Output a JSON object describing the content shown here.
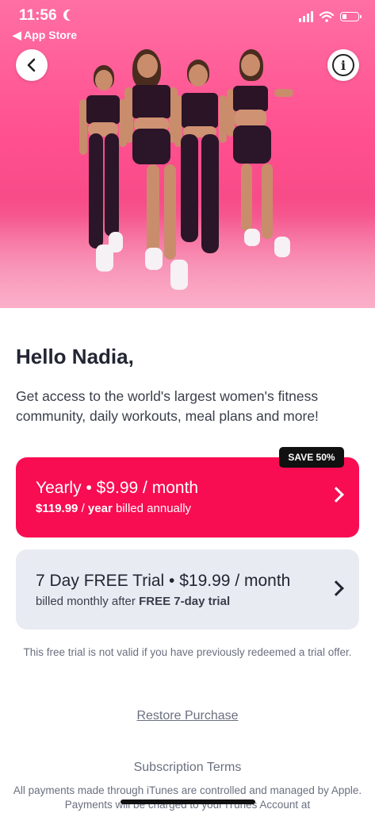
{
  "status_bar": {
    "time": "11:56",
    "back_label": "◀ App Store",
    "battery_level": 0.3
  },
  "icons": {
    "back": "chevron-left-icon",
    "info": "info-icon",
    "plan_chevron": "chevron-right-icon"
  },
  "colors": {
    "accent": "#f80d52",
    "trial_card": "#e9ebf3",
    "badge": "#111111"
  },
  "greeting": "Hello Nadia,",
  "subtitle": "Get access to the world's largest women's fitness community, daily workouts, meal plans and more!",
  "plans": [
    {
      "badge": "SAVE 50%",
      "name": "Yearly",
      "price": "$9.99",
      "period": "/ month",
      "billing_amount": "$119.99",
      "billing_unit": "year",
      "billing_note": "billed annually"
    },
    {
      "name": "7 Day FREE Trial",
      "price": "$19.99",
      "period": "/ month",
      "billing_prefix": "billed monthly after",
      "billing_bold": "FREE 7-day trial"
    }
  ],
  "disclaimer": "This free trial is not valid if you have previously redeemed a trial offer.",
  "restore_label": "Restore Purchase",
  "terms": {
    "title": "Subscription Terms",
    "body": "All payments made through iTunes are controlled and managed by Apple. Payments will be charged to your iTunes Account at"
  }
}
